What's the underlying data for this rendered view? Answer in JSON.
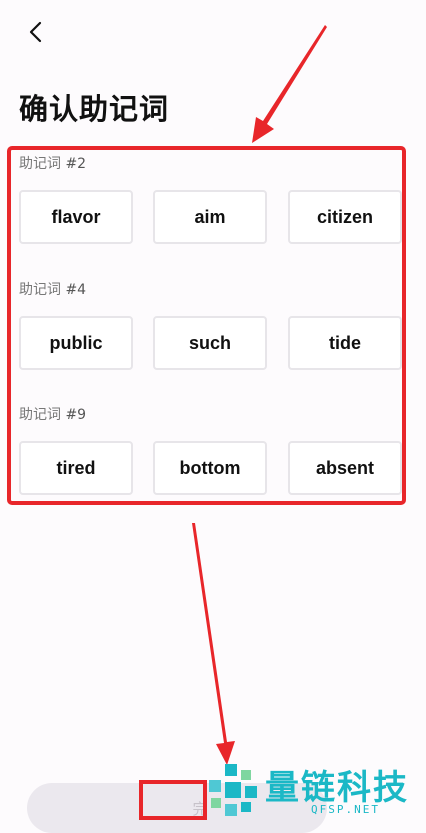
{
  "header": {
    "title": "确认助记词"
  },
  "groups": [
    {
      "label_prefix": "助记词",
      "label_index": "#2",
      "words": [
        "flavor",
        "aim",
        "citizen"
      ]
    },
    {
      "label_prefix": "助记词",
      "label_index": "#4",
      "words": [
        "public",
        "such",
        "tide"
      ]
    },
    {
      "label_prefix": "助记词",
      "label_index": "#9",
      "words": [
        "tired",
        "bottom",
        "absent"
      ]
    }
  ],
  "footer": {
    "done_label": "完"
  },
  "watermark": {
    "name": "量链科技",
    "domain": "QFSP.NET"
  },
  "colors": {
    "annotation": "#e8262a",
    "watermark": "#1bb8c6"
  }
}
